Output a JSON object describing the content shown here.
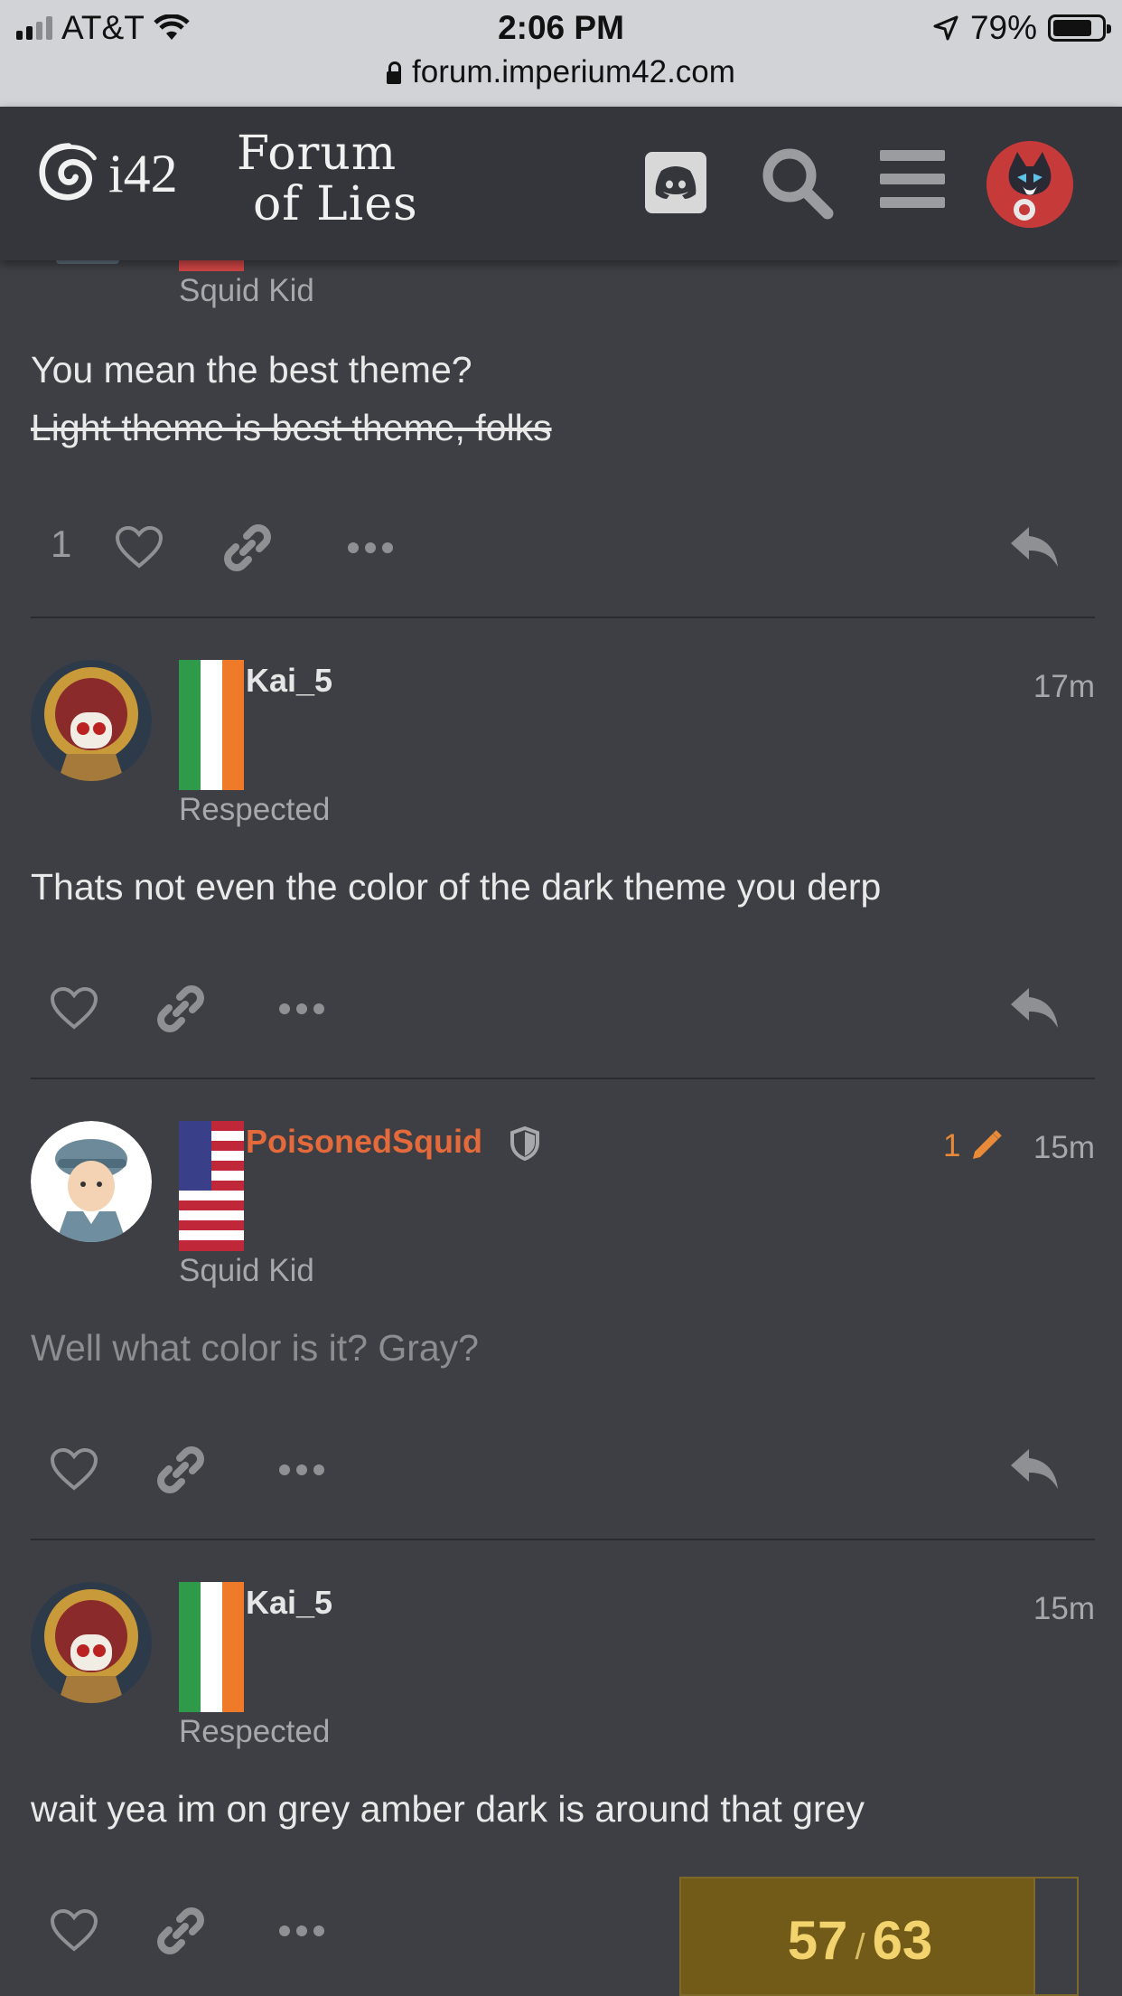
{
  "status_bar": {
    "carrier": "AT&T",
    "time": "2:06 PM",
    "battery": "79%",
    "url": "forum.imperium42.com"
  },
  "header": {
    "site_logo": "i42",
    "forum_name_line1": "Forum",
    "forum_name_line2": "of Lies",
    "icons": [
      "discord-icon",
      "search-icon",
      "hamburger-menu-icon",
      "user-avatar"
    ]
  },
  "posts": [
    {
      "user_title": "Squid Kid",
      "body_line1": "You mean the best theme?",
      "body_line2_struck": "Light theme is best theme, folks",
      "like_count": "1"
    },
    {
      "username": "Kai_5",
      "time": "17m",
      "user_title": "Respected",
      "body": "Thats not even the color of the dark theme you derp"
    },
    {
      "username": "PoisonedSquid",
      "edit_count": "1",
      "time": "15m",
      "user_title": "Squid Kid",
      "body": "Well what color is it? Gray?"
    },
    {
      "username": "Kai_5",
      "time": "15m",
      "user_title": "Respected",
      "body": "wait yea im on grey amber dark is around that grey"
    }
  ],
  "timeline": {
    "current": "57",
    "separator": "/",
    "total": "63"
  },
  "colors": {
    "background": "#3d3f44",
    "header": "#34363b",
    "moderator_name": "#e46a3b",
    "timeline_bg": "#725b18",
    "timeline_text": "#f3d36d"
  }
}
